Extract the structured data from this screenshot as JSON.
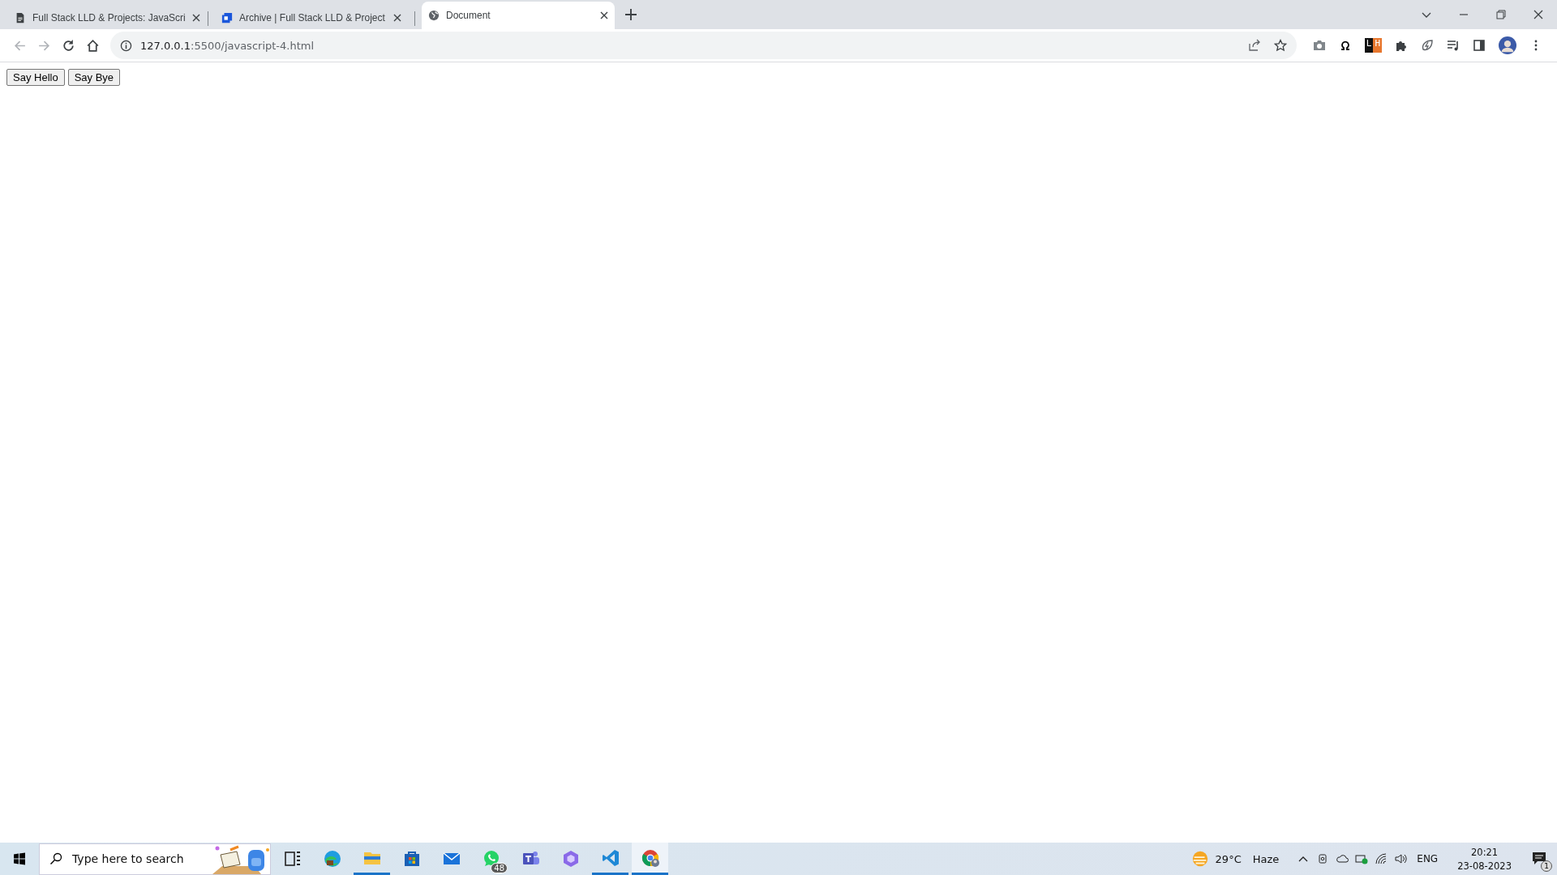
{
  "browser": {
    "tabs": [
      {
        "title": "Full Stack LLD & Projects: JavaScri",
        "kind": "document",
        "selected": false
      },
      {
        "title": "Archive | Full Stack LLD & Project",
        "kind": "archive",
        "selected": false
      },
      {
        "title": "Document",
        "kind": "globe",
        "selected": true
      }
    ],
    "address_bar": {
      "host": "127.0.0.1",
      "path": ":5500/javascript-4.html"
    },
    "extensions": [
      {
        "kind": "camera"
      },
      {
        "kind": "omega"
      },
      {
        "kind": "lh",
        "text_1": "L",
        "text_2": "H"
      },
      {
        "kind": "puzzle"
      },
      {
        "kind": "leaf"
      },
      {
        "kind": "playlist"
      },
      {
        "kind": "sidepanel"
      }
    ]
  },
  "page": {
    "buttons": [
      "Say Hello",
      "Say Bye"
    ]
  },
  "taskbar": {
    "search": {
      "placeholder": "Type here to search"
    },
    "apps": [
      {
        "kind": "taskview",
        "running": false,
        "selected": false
      },
      {
        "kind": "edge",
        "running": false,
        "selected": false
      },
      {
        "kind": "folder",
        "running": true,
        "selected": false
      },
      {
        "kind": "store",
        "running": false,
        "selected": false
      },
      {
        "kind": "mail",
        "running": false,
        "selected": false
      },
      {
        "kind": "whatsapp",
        "running": false,
        "selected": false,
        "badge": "48"
      },
      {
        "kind": "teams",
        "running": false,
        "selected": false
      },
      {
        "kind": "copilot",
        "running": false,
        "selected": false
      },
      {
        "kind": "vscode",
        "running": true,
        "selected": false
      },
      {
        "kind": "chrome",
        "running": true,
        "selected": true
      }
    ],
    "weather": {
      "temperature": "29°C",
      "condition": "Haze"
    },
    "language": "ENG",
    "time": "20:21",
    "date": "23-08-2023",
    "notifications": "1"
  }
}
